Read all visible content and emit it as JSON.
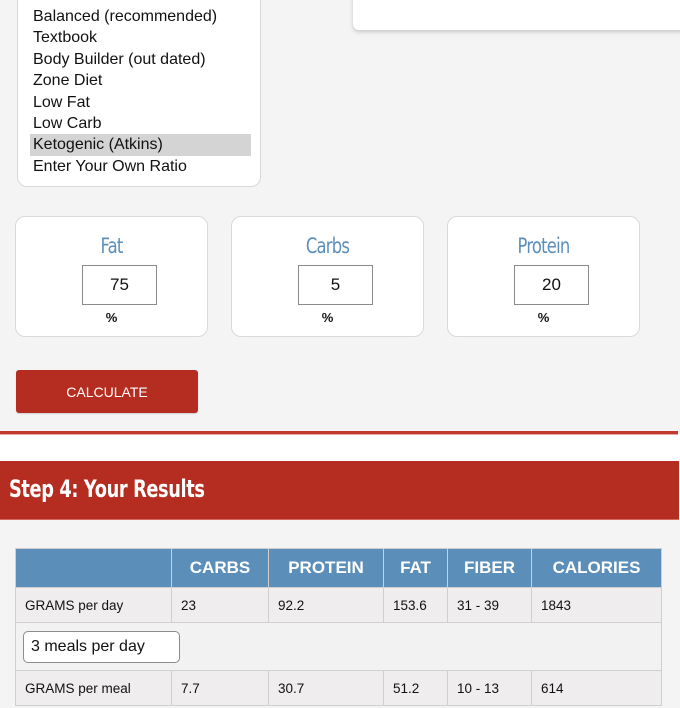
{
  "diet_ratio": {
    "options": [
      {
        "label": "Balanced (recommended)",
        "selected": false
      },
      {
        "label": "Textbook",
        "selected": false
      },
      {
        "label": "Body Builder (out dated)",
        "selected": false
      },
      {
        "label": "Zone Diet",
        "selected": false
      },
      {
        "label": "Low Fat",
        "selected": false
      },
      {
        "label": "Low Carb",
        "selected": false
      },
      {
        "label": "Ketogenic (Atkins)",
        "selected": true
      },
      {
        "label": "Enter Your Own Ratio",
        "selected": false
      }
    ]
  },
  "macros": [
    {
      "label": "Fat",
      "value": "75",
      "unit": "%"
    },
    {
      "label": "Carbs",
      "value": "5",
      "unit": "%"
    },
    {
      "label": "Protein",
      "value": "20",
      "unit": "%"
    }
  ],
  "calculate_label": "CALCULATE",
  "step4": {
    "title": "Step 4: Your Results"
  },
  "colors": {
    "accent_red": "#b52d20",
    "header_blue": "#5b8fba"
  },
  "results": {
    "columns": [
      "",
      "CARBS",
      "PROTEIN",
      "FAT",
      "FIBER",
      "CALORIES"
    ],
    "per_day": {
      "label": "GRAMS per day",
      "values": [
        "23",
        "92.2",
        "153.6",
        "31 - 39",
        "1843"
      ]
    },
    "meals_select": "3 meals per day",
    "per_meal": {
      "label": "GRAMS per meal",
      "values": [
        "7.7",
        "30.7",
        "51.2",
        "10 - 13",
        "614"
      ]
    }
  }
}
